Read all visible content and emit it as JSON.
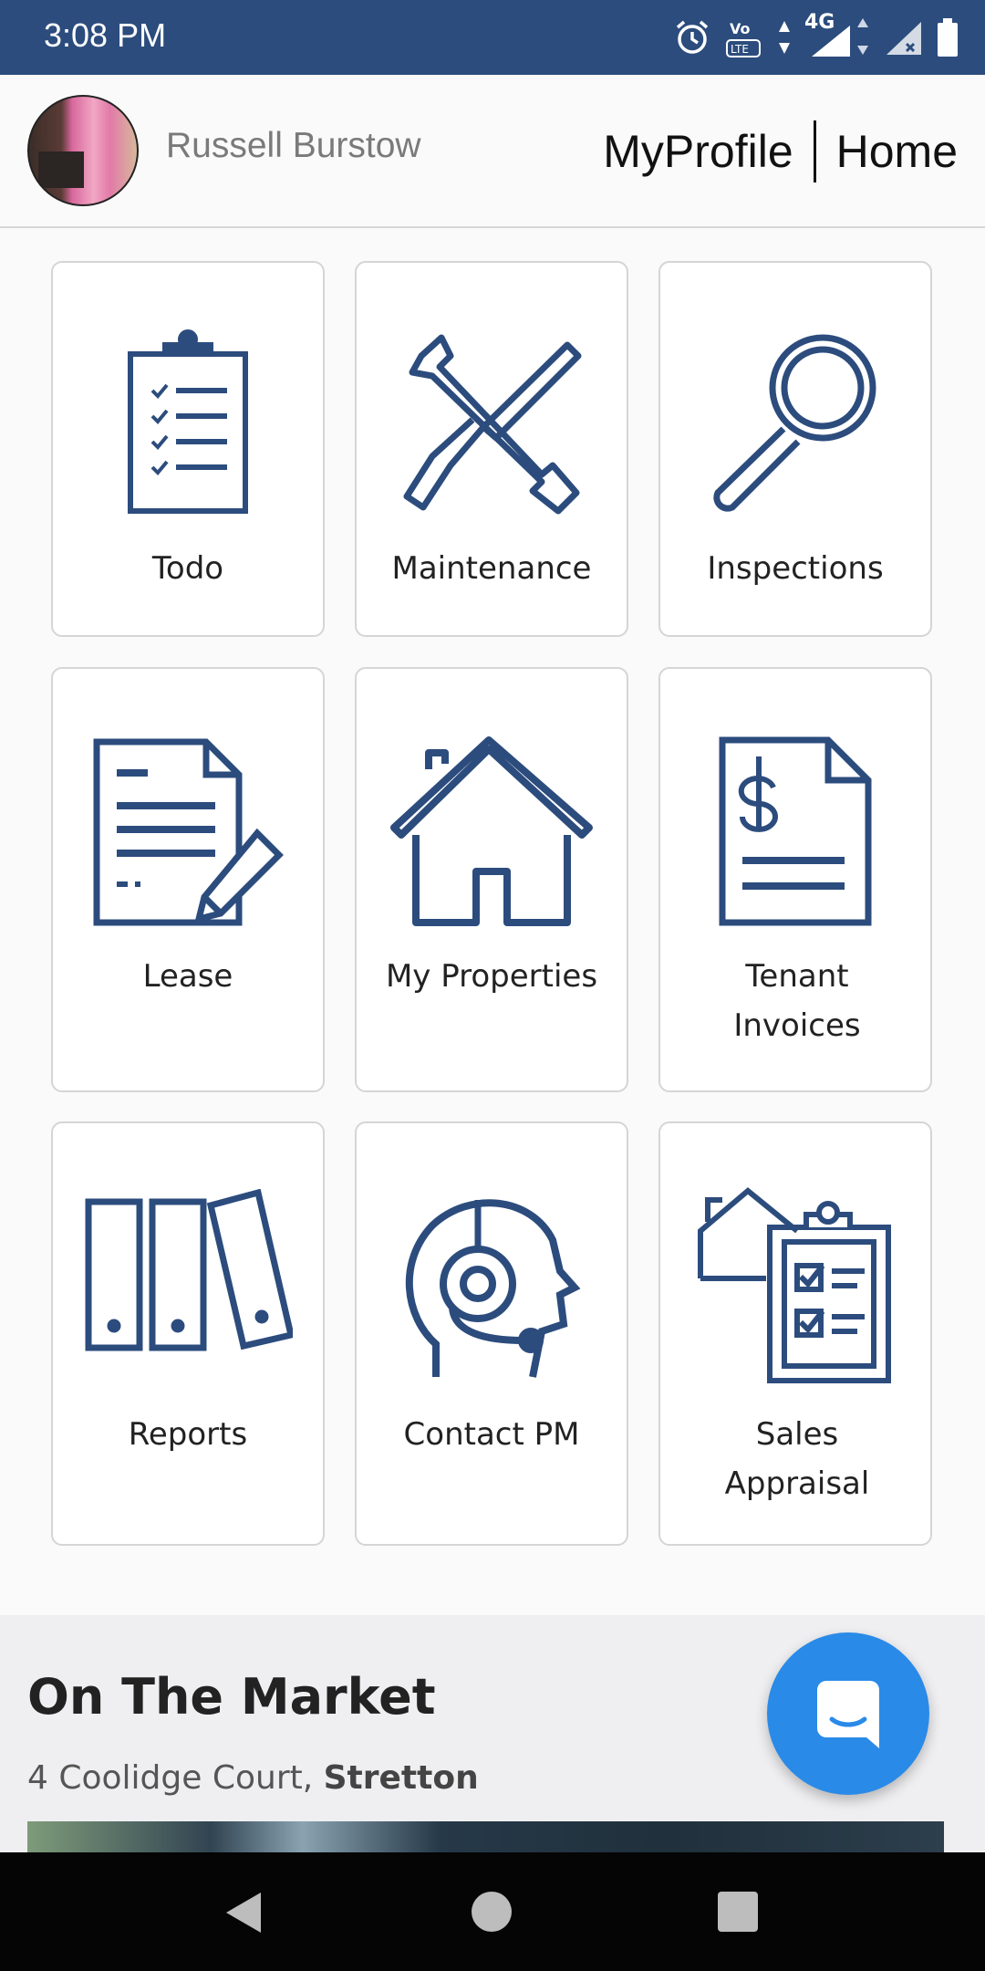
{
  "status_bar": {
    "time": "3:08 PM",
    "network": "4G",
    "icons": [
      "alarm-icon",
      "volte-icon",
      "signal-icon",
      "signal-x-icon",
      "battery-icon"
    ]
  },
  "header": {
    "user_name": "Russell Burstow",
    "nav": [
      "MyProfile",
      "Home"
    ]
  },
  "tiles": [
    {
      "label": "Todo",
      "icon": "clipboard-checklist-icon"
    },
    {
      "label": "Maintenance",
      "icon": "wrench-screwdriver-icon"
    },
    {
      "label": "Inspections",
      "icon": "magnifier-icon"
    },
    {
      "label": "Lease",
      "icon": "document-pencil-icon"
    },
    {
      "label": "My Properties",
      "icon": "house-icon"
    },
    {
      "label": "Tenant Invoices",
      "icon": "invoice-dollar-icon"
    },
    {
      "label": "Reports",
      "icon": "binders-icon"
    },
    {
      "label": "Contact PM",
      "icon": "headset-head-icon"
    },
    {
      "label": "Sales Appraisal",
      "icon": "house-clipboard-icon"
    }
  ],
  "market": {
    "title": "On The Market",
    "address_street": "4 Coolidge Court,",
    "address_suburb": "Stretton"
  },
  "chat_button": {
    "icon": "chat-bubble-icon"
  },
  "colors": {
    "status_bar": "#2c4c7d",
    "icon_blue": "#2c4c7d",
    "fab": "#2a8ae8"
  }
}
